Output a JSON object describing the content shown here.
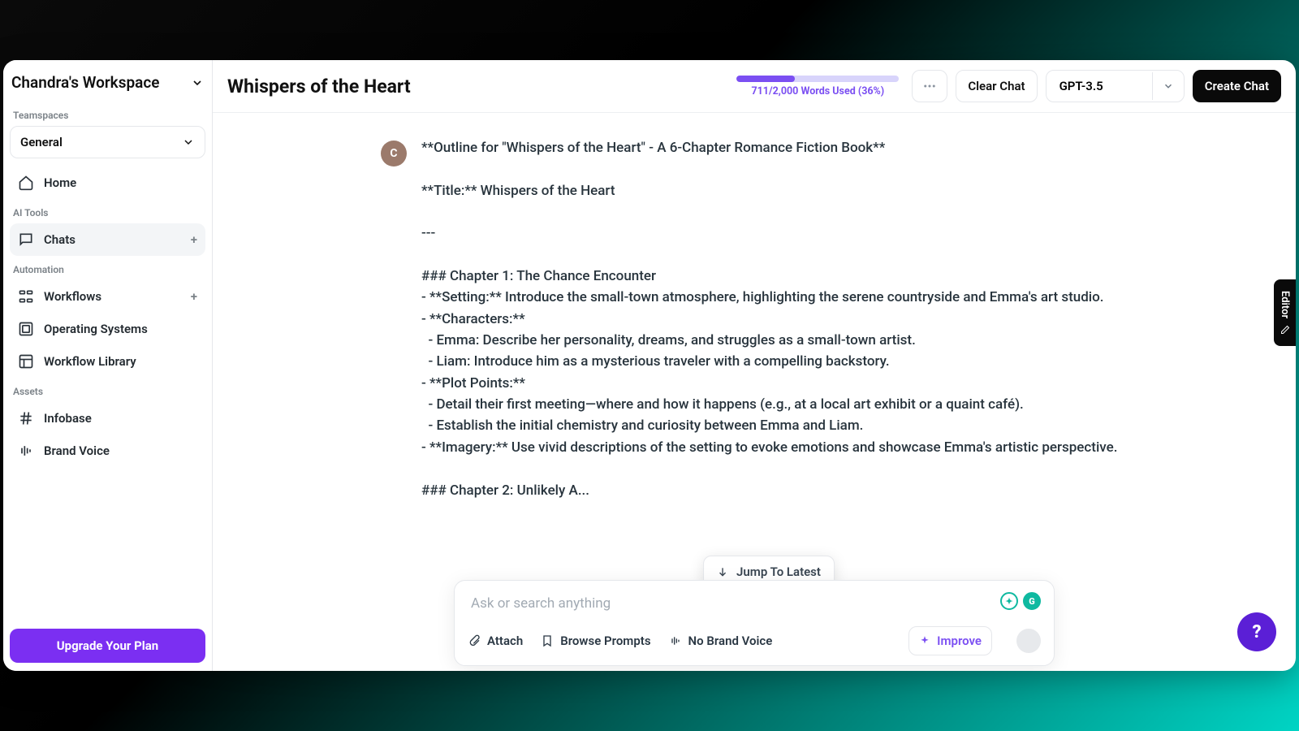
{
  "workspace": {
    "name": "Chandra's Workspace"
  },
  "sidebar": {
    "labels": {
      "teamspaces": "Teamspaces",
      "ai_tools": "AI Tools",
      "automation": "Automation",
      "assets": "Assets"
    },
    "teamspace": "General",
    "nav": {
      "home": "Home",
      "chats": "Chats",
      "workflows": "Workflows",
      "operating_systems": "Operating Systems",
      "workflow_library": "Workflow Library",
      "infobase": "Infobase",
      "brand_voice": "Brand Voice"
    },
    "upgrade": "Upgrade Your Plan"
  },
  "header": {
    "title": "Whispers of the Heart",
    "usage": {
      "text": "711/2,000 Words Used (36%)",
      "percent": 36
    },
    "clear": "Clear Chat",
    "model": "GPT-3.5",
    "create": "Create Chat"
  },
  "chat": {
    "avatar_initial": "C",
    "message": "**Outline for \"Whispers of the Heart\" - A 6-Chapter Romance Fiction Book**\n\n**Title:** Whispers of the Heart\n\n---\n\n### Chapter 1: The Chance Encounter\n- **Setting:** Introduce the small-town atmosphere, highlighting the serene countryside and Emma's art studio.\n- **Characters:**\n  - Emma: Describe her personality, dreams, and struggles as a small-town artist.\n  - Liam: Introduce him as a mysterious traveler with a compelling backstory.\n- **Plot Points:**\n  - Detail their first meeting—where and how it happens (e.g., at a local art exhibit or a quaint café).\n  - Establish the initial chemistry and curiosity between Emma and Liam.\n- **Imagery:** Use vivid descriptions of the setting to evoke emotions and showcase Emma's artistic perspective.\n\n### Chapter 2: Unlikely A..."
  },
  "jump": "Jump To Latest",
  "composer": {
    "placeholder": "Ask or search anything",
    "attach": "Attach",
    "browse": "Browse Prompts",
    "brand_voice": "No Brand Voice",
    "improve": "Improve"
  },
  "editor_tab": "Editor",
  "badges": {
    "g": "G"
  }
}
